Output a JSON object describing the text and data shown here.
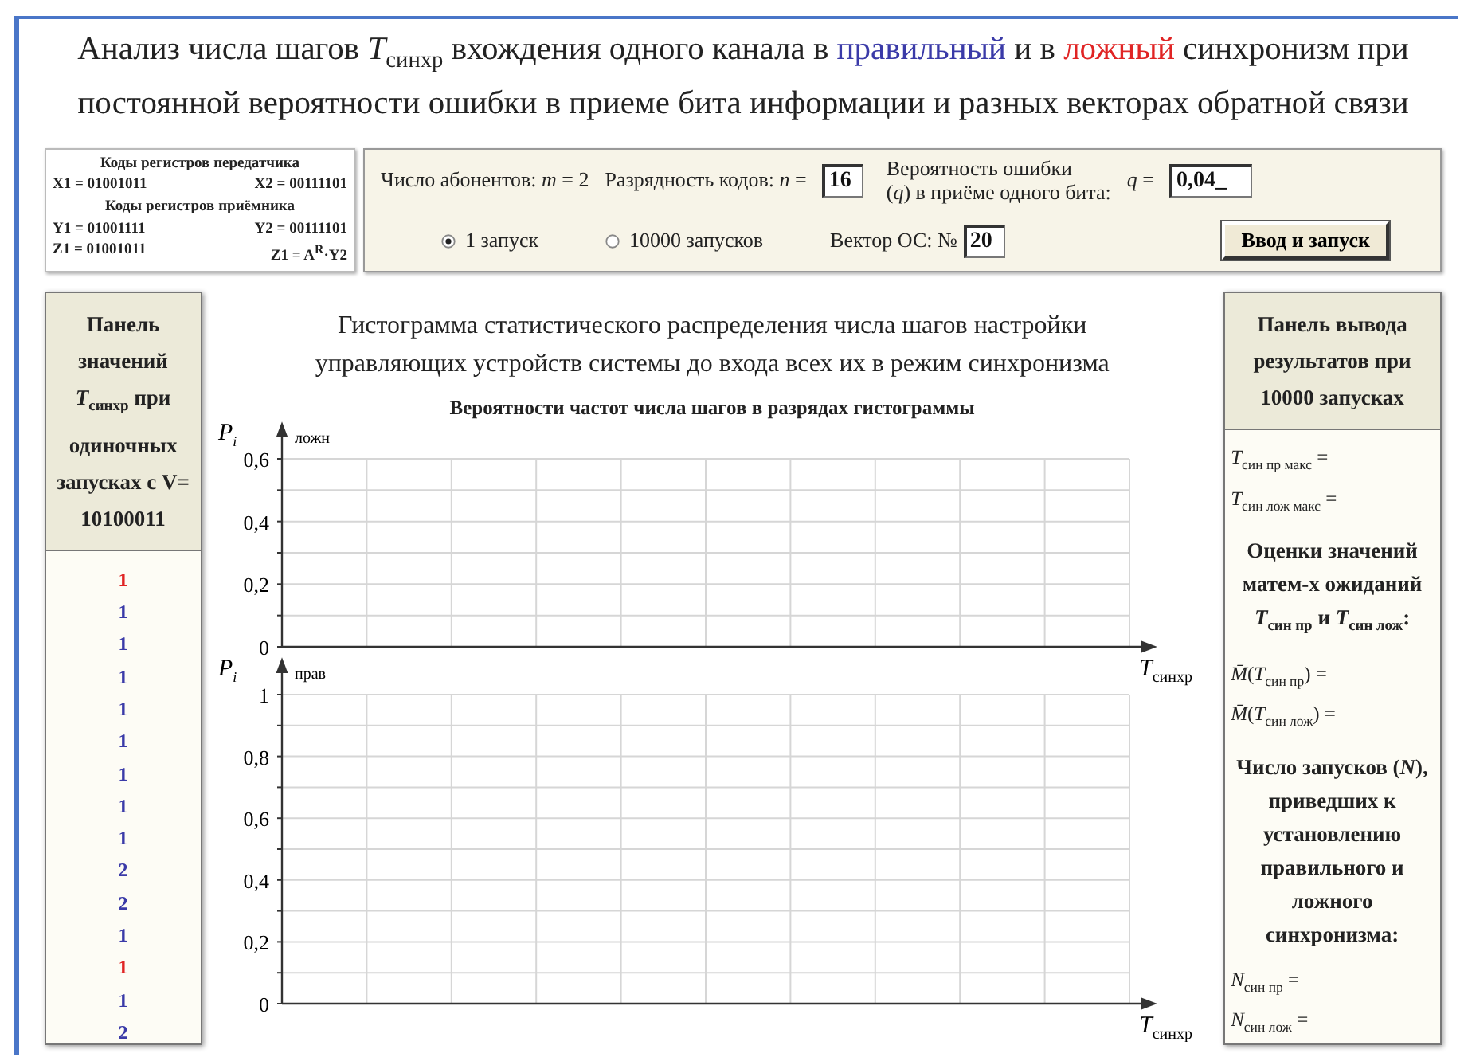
{
  "title_lines": [
    [
      {
        "text": "Анализ числа шагов *T*$_{синхр}$ вхождения одного канала в ",
        "color": "#222222"
      },
      {
        "text": "правильный",
        "color": "#3a3aa8"
      },
      {
        "text": " и в ",
        "color": "#222222"
      },
      {
        "text": "ложный",
        "color": "#e02424"
      },
      {
        "text": " синхронизм при",
        "color": "#222222"
      }
    ],
    [
      {
        "text": "постоянной вероятности ошибки в приеме бита информации и разных векторах обратной связи",
        "color": "#222222"
      }
    ]
  ],
  "registers": {
    "transmitter_heading": "Коды регистров передатчика",
    "transmitter": [
      "X1 = 01001011",
      "X2 = 00111101"
    ],
    "receiver_heading": "Коды регистров приёмника",
    "receiver": [
      [
        "Y1 = 01001111",
        "Y2 = 00111101"
      ],
      [
        "Z1 = 01001011",
        "Z1 = A$^{R}$·Y2"
      ]
    ]
  },
  "controls": {
    "subscribers": "Число абонентов: *m* = 2",
    "code_length_label": "Разрядность кодов: *n* =",
    "code_length": "16",
    "error_label": "Вероятность ошибки\n(*q*) в приёме одного бита:",
    "q_label": "*q* =",
    "q": "0,04_",
    "runs": [
      {
        "label": "1 запуск",
        "selected": true
      },
      {
        "label": "10000 запусков",
        "selected": false
      }
    ],
    "vector_label": "Вектор ОС:  №",
    "vector": "20",
    "start_button": "Ввод и запуск"
  },
  "left_panel": {
    "header": "Панель значений *T*$_{синхр}$ при одиночных запусках с V= 10100011",
    "values": [
      {
        "value": "1",
        "color": "#e02424"
      },
      {
        "value": "1",
        "color": "#3a3aa8"
      },
      {
        "value": "1",
        "color": "#3a3aa8"
      },
      {
        "value": "1",
        "color": "#3a3aa8"
      },
      {
        "value": "1",
        "color": "#3a3aa8"
      },
      {
        "value": "1",
        "color": "#3a3aa8"
      },
      {
        "value": "1",
        "color": "#3a3aa8"
      },
      {
        "value": "1",
        "color": "#3a3aa8"
      },
      {
        "value": "1",
        "color": "#3a3aa8"
      },
      {
        "value": "2",
        "color": "#3a3aa8"
      },
      {
        "value": "2",
        "color": "#3a3aa8"
      },
      {
        "value": "1",
        "color": "#3a3aa8"
      },
      {
        "value": "1",
        "color": "#e02424"
      },
      {
        "value": "1",
        "color": "#3a3aa8"
      },
      {
        "value": "2",
        "color": "#3a3aa8"
      }
    ]
  },
  "histogram": {
    "title": "Гистограмма статистического распределения числа шагов настройки управляющих устройств системы до входа всех их в режим синхронизма",
    "subtitle": "Вероятности частот числа шагов в разрядах гистограммы",
    "plots": [
      {
        "y_label": "P",
        "y_sub": "i",
        "series_label": "ложн",
        "x_label": "T",
        "x_sub": "синхр",
        "ticks": [
          "0,6",
          "0,4",
          "0,2",
          "0"
        ]
      },
      {
        "y_label": "P",
        "y_sub": "i",
        "series_label": "прав",
        "x_label": "T",
        "x_sub": "синхр",
        "ticks": [
          "1",
          "0,8",
          "0,6",
          "0,4",
          "0,2",
          "0"
        ]
      }
    ]
  },
  "right_panel": {
    "header": "Панель вывода результатов при 10000 запусках",
    "lines": [
      {
        "kind": "formula",
        "text": "*T*$_{син пр макс}$ ="
      },
      {
        "kind": "formula",
        "text": "*T*$_{син лож макс}$ ="
      },
      {
        "kind": "note",
        "text": "Оценки значений матем-х ожиданий *T*$_{син пр}$ и *T*$_{син лож}$:"
      },
      {
        "kind": "formula",
        "text": "*M̄*(*T*$_{син пр}$) ="
      },
      {
        "kind": "formula",
        "text": "*M̄*(*T*$_{син лож}$) ="
      },
      {
        "kind": "note",
        "text": "Число запусков (*N*), приведших к установлению правильного и ложного синхронизма:"
      },
      {
        "kind": "formula",
        "text": "*N*$_{син пр}$ ="
      },
      {
        "kind": "formula",
        "text": "*N*$_{син лож}$ ="
      }
    ]
  }
}
